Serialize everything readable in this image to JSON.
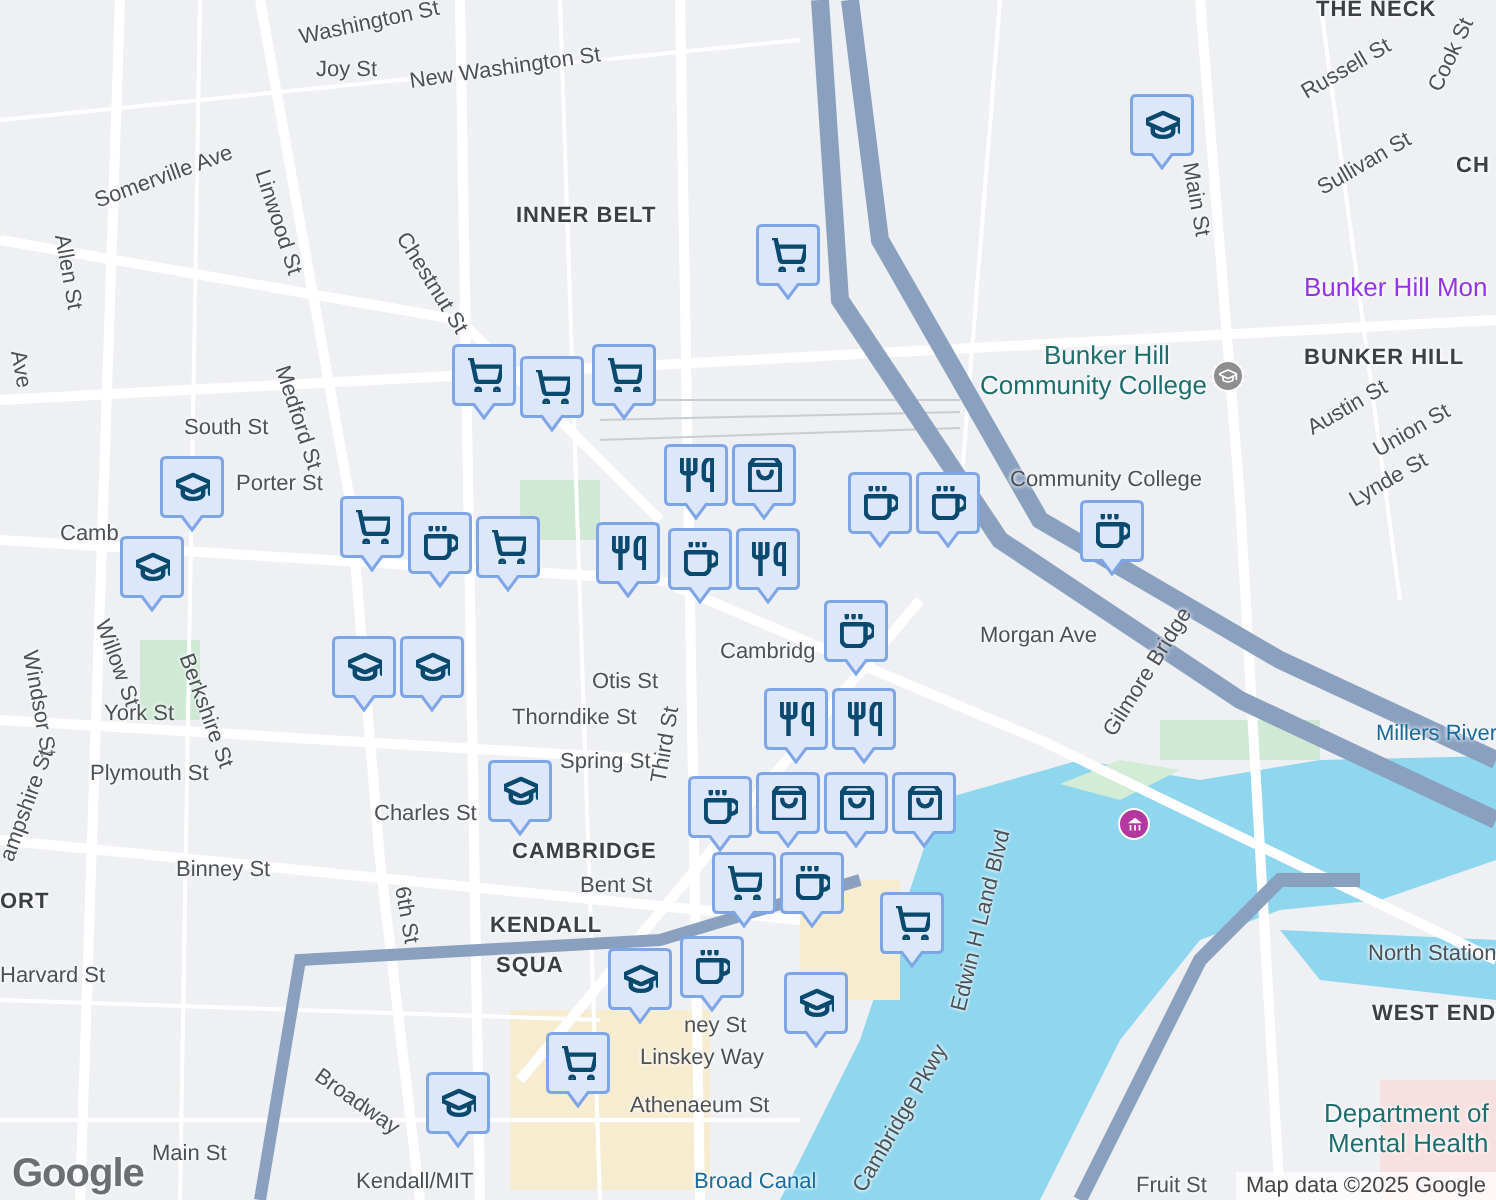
{
  "map": {
    "labels": [
      {
        "text": "Washington St",
        "kind": "street"
      },
      {
        "text": "New Washington St",
        "kind": "street"
      },
      {
        "text": "Joy St",
        "kind": "street"
      },
      {
        "text": "Linwood St",
        "kind": "street"
      },
      {
        "text": "Somerville Ave",
        "kind": "street"
      },
      {
        "text": "Allen St",
        "kind": "street"
      },
      {
        "text": "Chestnut St",
        "kind": "street"
      },
      {
        "text": "INNER BELT",
        "kind": "district"
      },
      {
        "text": "Medford St",
        "kind": "street"
      },
      {
        "text": "South St",
        "kind": "street"
      },
      {
        "text": "Porter St",
        "kind": "street"
      },
      {
        "text": "Camb",
        "kind": "street"
      },
      {
        "text": "Windsor St",
        "kind": "street"
      },
      {
        "text": "Willow St",
        "kind": "street"
      },
      {
        "text": "Berkshire St",
        "kind": "street"
      },
      {
        "text": "York St",
        "kind": "street"
      },
      {
        "text": "Plymouth St",
        "kind": "street"
      },
      {
        "text": "ampshire St",
        "kind": "street"
      },
      {
        "text": "ORT",
        "kind": "district"
      },
      {
        "text": "Harvard St",
        "kind": "street"
      },
      {
        "text": "Binney St",
        "kind": "street"
      },
      {
        "text": "Charles St",
        "kind": "street"
      },
      {
        "text": "6th St",
        "kind": "street"
      },
      {
        "text": "Otis St",
        "kind": "street"
      },
      {
        "text": "Thorndike St",
        "kind": "street"
      },
      {
        "text": "Spring St",
        "kind": "street"
      },
      {
        "text": "Third St",
        "kind": "street"
      },
      {
        "text": "Cambridg",
        "kind": "street"
      },
      {
        "text": "CAMBRIDGE",
        "kind": "district"
      },
      {
        "text": "Bent St",
        "kind": "street"
      },
      {
        "text": "KENDALL",
        "kind": "district"
      },
      {
        "text": "SQUA",
        "kind": "district"
      },
      {
        "text": "ney St",
        "kind": "street"
      },
      {
        "text": "Linskey Way",
        "kind": "street"
      },
      {
        "text": "Athenaeum St",
        "kind": "street"
      },
      {
        "text": "Broadway",
        "kind": "street"
      },
      {
        "text": "Main St",
        "kind": "street"
      },
      {
        "text": "Kendall/MIT",
        "kind": "street"
      },
      {
        "text": "Broad Canal",
        "kind": "water"
      },
      {
        "text": "Cambridge Pkwy",
        "kind": "street"
      },
      {
        "text": "Edwin H Land Blvd",
        "kind": "street"
      },
      {
        "text": "Morgan Ave",
        "kind": "street"
      },
      {
        "text": "Gilmore Bridge",
        "kind": "street"
      },
      {
        "text": "THE NECK",
        "kind": "district"
      },
      {
        "text": "Cook St",
        "kind": "street"
      },
      {
        "text": "Russell St",
        "kind": "street"
      },
      {
        "text": "Main St",
        "kind": "street"
      },
      {
        "text": "Sullivan St",
        "kind": "street"
      },
      {
        "text": "CH",
        "kind": "district"
      },
      {
        "text": "Bunker Hill Mon",
        "kind": "landmark"
      },
      {
        "text": "Bunker Hill",
        "kind": "place"
      },
      {
        "text": "BUNKER HILL",
        "kind": "district"
      },
      {
        "text": "Community College",
        "kind": "place"
      },
      {
        "text": "Community College",
        "kind": "street"
      },
      {
        "text": "Austin St",
        "kind": "street"
      },
      {
        "text": "Union St",
        "kind": "street"
      },
      {
        "text": "Lynde St",
        "kind": "street"
      },
      {
        "text": "Millers River",
        "kind": "water"
      },
      {
        "text": "North Station",
        "kind": "street"
      },
      {
        "text": "WEST END",
        "kind": "district"
      },
      {
        "text": "Department of",
        "kind": "place"
      },
      {
        "text": "Mental Health",
        "kind": "place"
      },
      {
        "text": "Fruit St",
        "kind": "street"
      },
      {
        "text": "Ave",
        "kind": "street"
      }
    ],
    "pins": [
      {
        "kind": "school"
      },
      {
        "kind": "grocery"
      },
      {
        "kind": "grocery"
      },
      {
        "kind": "grocery"
      },
      {
        "kind": "grocery"
      },
      {
        "kind": "school"
      },
      {
        "kind": "school"
      },
      {
        "kind": "grocery"
      },
      {
        "kind": "cafe"
      },
      {
        "kind": "grocery"
      },
      {
        "kind": "restaurant"
      },
      {
        "kind": "restaurant"
      },
      {
        "kind": "shopping"
      },
      {
        "kind": "cafe"
      },
      {
        "kind": "restaurant"
      },
      {
        "kind": "cafe"
      },
      {
        "kind": "cafe"
      },
      {
        "kind": "cafe"
      },
      {
        "kind": "cafe"
      },
      {
        "kind": "restaurant"
      },
      {
        "kind": "restaurant"
      },
      {
        "kind": "cafe"
      },
      {
        "kind": "shopping"
      },
      {
        "kind": "shopping"
      },
      {
        "kind": "shopping"
      },
      {
        "kind": "school"
      },
      {
        "kind": "school"
      },
      {
        "kind": "school"
      },
      {
        "kind": "grocery"
      },
      {
        "kind": "cafe"
      },
      {
        "kind": "grocery"
      },
      {
        "kind": "cafe"
      },
      {
        "kind": "school"
      },
      {
        "kind": "school"
      },
      {
        "kind": "grocery"
      },
      {
        "kind": "school"
      }
    ],
    "logo": "Google",
    "attribution": "Map data ©2025 Google"
  }
}
